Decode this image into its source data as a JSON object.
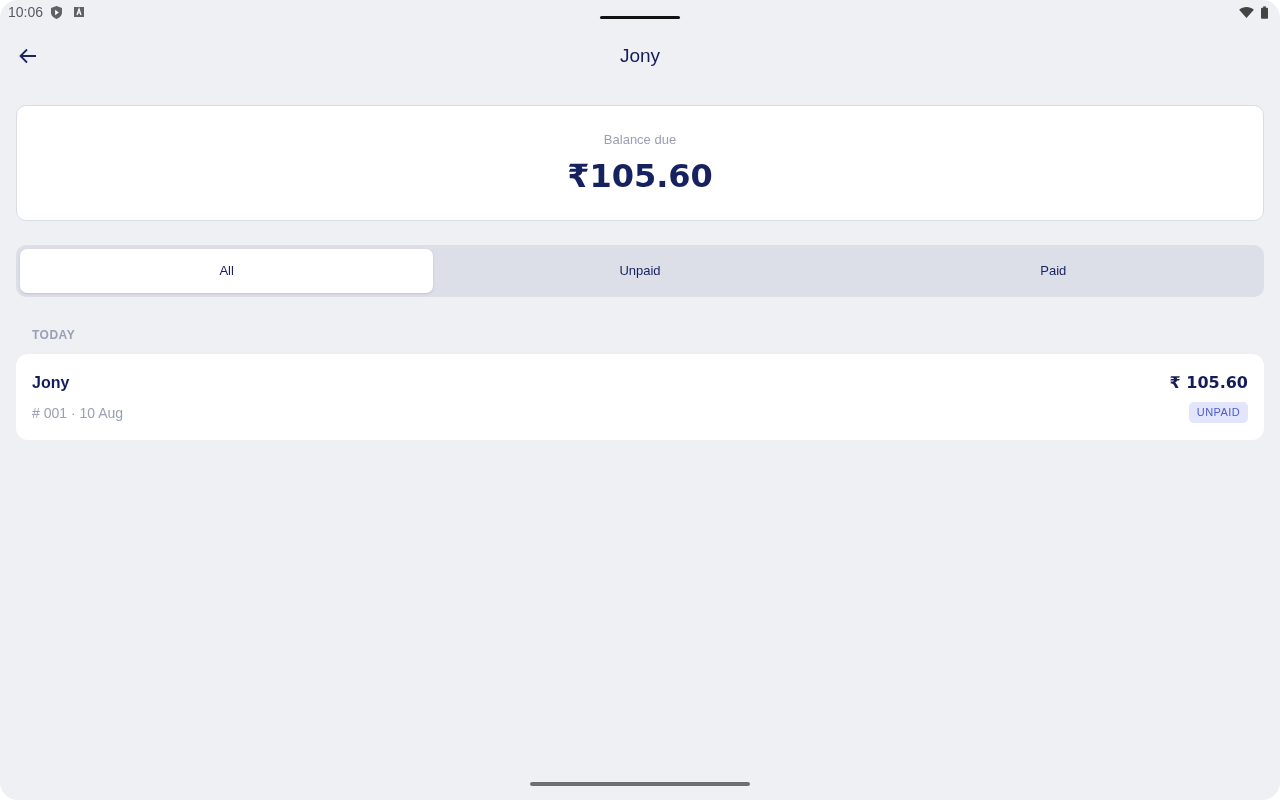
{
  "status_bar": {
    "time": "10:06"
  },
  "header": {
    "title": "Jony"
  },
  "balance": {
    "label": "Balance due",
    "amount": "₹105.60"
  },
  "tabs": [
    {
      "label": "All",
      "selected": true
    },
    {
      "label": "Unpaid",
      "selected": false
    },
    {
      "label": "Paid",
      "selected": false
    }
  ],
  "sections": [
    {
      "heading": "TODAY",
      "invoices": [
        {
          "customer": "Jony",
          "meta": "# 001 · 10 Aug",
          "amount": "₹ 105.60",
          "status": {
            "kind": "unpaid",
            "label": "UNPAID"
          }
        }
      ]
    }
  ]
}
